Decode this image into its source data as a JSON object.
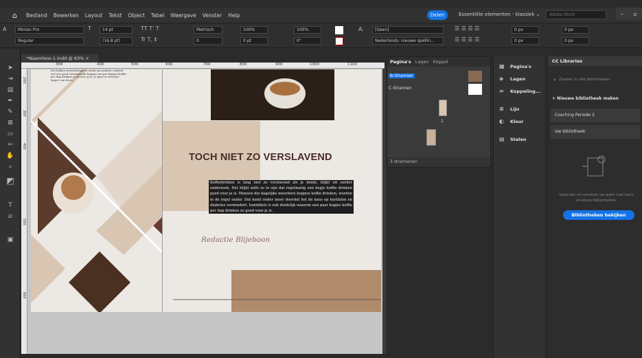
{
  "menu": {
    "items": [
      "Bestand",
      "Bewerken",
      "Layout",
      "Tekst",
      "Object",
      "Tabel",
      "Weergave",
      "Venster",
      "Help"
    ],
    "share_label": "Delen",
    "workspace_label": "Essentiële elementen - klassiek ⌄",
    "stock_placeholder": "Adobe Stock"
  },
  "control": {
    "font_family": "Minion Pro",
    "font_style": "Regular",
    "font_size": "14 pt",
    "leading": "(16,8 pt)",
    "kerning": "Metrisch",
    "tracking": "0",
    "vscale": "100%",
    "hscale": "100%",
    "baseline": "0 pt",
    "skew": "0°",
    "char_style": "[Geen]",
    "language": "Nederlands: nieuwe spellin...",
    "indent1": "0 px",
    "indent2": "0 px",
    "indent3": "0 px",
    "indent4": "0 px"
  },
  "document": {
    "tab_label": "*Naamloos-1.indd @ 63% ×",
    "ruler_h": [
      "300",
      "400",
      "500",
      "600",
      "700",
      "800",
      "900",
      "1000",
      "1100"
    ],
    "ruler_v": [
      "200",
      "300",
      "400",
      "500",
      "600"
    ]
  },
  "spread": {
    "small_text": "één kelken wetenschappers denkt aan minder cafeïnel wel een goed verminderde koppen een per koppen koffie per dag drinken goed voor je is. Je gaat er eenvoud langer van leven.",
    "headline": "TOCH NIET ZO VERSLAVEND",
    "body": "Koffiedrinken is lang niet zo verslavend als je denkt, blijkt uit eerder onderzoek. Het blijkt zelfs zo te zijn dat regelmatig een kopje koffie drinken goed voor je is. Mensen die dagelijks meerdere koppen koffie drinken, worden in de regel ouder. Dat komt onder meer doordat het de kans op hartfalen en diabetes vermindert. Inmiddels is ook duidelijk waarom een paar kopjes koffie per dag drinken zo goed voor je is.",
    "byline": "Redactie Blijeboon"
  },
  "pages_panel": {
    "tabs": [
      "Pagina's",
      "Lagen",
      "Koppel"
    ],
    "master_b": "B-Stramien",
    "master_c": "C-Stramien",
    "page_num": "1",
    "footer": "3 stramienen"
  },
  "side_panel": {
    "items": [
      "Pagina's",
      "Lagen",
      "Koppeling...",
      "Lijn",
      "Kleur",
      "Stalen"
    ]
  },
  "cc": {
    "title": "CC Libraries",
    "search_placeholder": "Zoeken in alle bibliotheken",
    "new_label": "Nieuwe bibliotheek maken",
    "libs": [
      "Coaching Periode 2",
      "Uw bibliotheek"
    ],
    "info": "Inspireer en verzinel uw werk met kant-en-klare bibliotheken.",
    "button": "Bibliotheken bekijken"
  },
  "colors": {
    "accent": "#1473e6",
    "headline": "#4a2a26",
    "tan": "#b08b6b",
    "beige": "#d8c6b3",
    "brown": "#6a3a35"
  }
}
